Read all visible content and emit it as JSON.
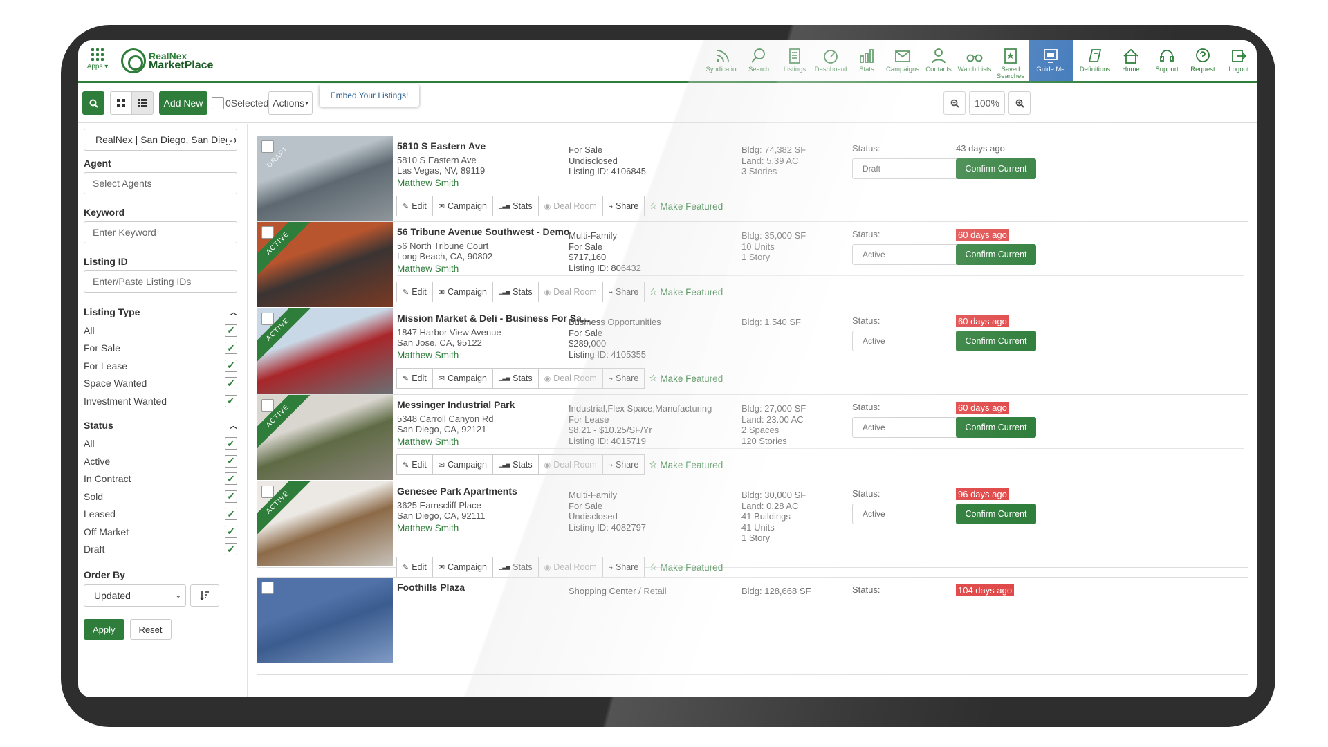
{
  "header": {
    "apps_label": "Apps",
    "logo_line1": "RealNex",
    "logo_line2": "MarketPlace",
    "nav": [
      {
        "label": "Syndication",
        "icon": "rss-icon"
      },
      {
        "label": "Search",
        "icon": "search-icon"
      },
      {
        "label": "Listings",
        "icon": "document-icon"
      },
      {
        "label": "Dashboard",
        "icon": "gauge-icon"
      },
      {
        "label": "Stats",
        "icon": "bar-chart-icon"
      },
      {
        "label": "Campaigns",
        "icon": "envelope-icon"
      },
      {
        "label": "Contacts",
        "icon": "person-icon"
      },
      {
        "label": "Watch Lists",
        "icon": "binoculars-icon"
      },
      {
        "label": "Saved Searches",
        "icon": "bookmark-icon"
      },
      {
        "label": "Guide Me",
        "icon": "guide-icon",
        "active": true
      },
      {
        "label": "Definitions",
        "icon": "book-icon"
      },
      {
        "label": "Home",
        "icon": "home-icon"
      },
      {
        "label": "Support",
        "icon": "headset-icon"
      },
      {
        "label": "Request",
        "icon": "question-icon"
      },
      {
        "label": "Logout",
        "icon": "logout-icon"
      }
    ]
  },
  "toolbar": {
    "add_new": "Add New",
    "selected_count": "0",
    "selected_label": "Selected",
    "actions": "Actions",
    "embed": "Embed Your Listings!",
    "zoom": "100%"
  },
  "sidebar": {
    "account": "RealNex | San Diego, San Diego",
    "agent_label": "Agent",
    "agent_placeholder": "Select Agents",
    "keyword_label": "Keyword",
    "keyword_placeholder": "Enter Keyword",
    "listing_id_label": "Listing ID",
    "listing_id_placeholder": "Enter/Paste Listing IDs",
    "listing_type_label": "Listing Type",
    "listing_types": [
      "All",
      "For Sale",
      "For Lease",
      "Space Wanted",
      "Investment Wanted"
    ],
    "status_label": "Status",
    "statuses": [
      "All",
      "Active",
      "In Contract",
      "Sold",
      "Leased",
      "Off Market",
      "Draft"
    ],
    "order_label": "Order By",
    "order_value": "Updated",
    "apply": "Apply",
    "reset": "Reset"
  },
  "action_labels": {
    "edit": "Edit",
    "campaign": "Campaign",
    "stats": "Stats",
    "deal_room": "Deal Room",
    "share": "Share",
    "featured": "Make Featured",
    "status": "Status:",
    "confirm": "Confirm Current"
  },
  "listings": [
    {
      "title": "5810 S Eastern Ave",
      "addr1": "5810 S Eastern Ave",
      "addr2": "Las Vegas, NV, 89119",
      "agent": "Matthew Smith",
      "col2": [
        "For Sale",
        "Undisclosed",
        "Listing ID: 4106845"
      ],
      "col3": [
        "Bldg: 74,382 SF",
        "Land: 5.39 AC",
        "3 Stories"
      ],
      "status": "Draft",
      "ribbon": "DRAFT",
      "days": "43 days ago",
      "overdue": false,
      "photo_colors": [
        "#b9c2c8",
        "#5d6870",
        "#8e969b"
      ]
    },
    {
      "title": "56 Tribune Avenue Southwest - Demo",
      "addr1": "56 North Tribune Court",
      "addr2": "Long Beach, CA, 90802",
      "agent": "Matthew Smith",
      "col2": [
        "Multi-Family",
        "For Sale",
        "$717,160",
        "Listing ID: 806432"
      ],
      "col3": [
        "Bldg: 35,000 SF",
        "10 Units",
        "1 Story"
      ],
      "status": "Active",
      "ribbon": "ACTIVE",
      "days": "60 days ago",
      "overdue": true,
      "photo_colors": [
        "#b8552e",
        "#3a3433",
        "#7a3a24"
      ]
    },
    {
      "title": "Mission Market & Deli - Business For Sa...",
      "addr1": "1847 Harbor View Avenue",
      "addr2": "San Jose, CA, 95122",
      "agent": "Matthew Smith",
      "col2": [
        "Business Opportunities",
        "For Sale",
        "$289,000",
        "Listing ID: 4105355"
      ],
      "col3": [
        "Bldg: 1,540 SF"
      ],
      "status": "Active",
      "ribbon": "ACTIVE",
      "days": "60 days ago",
      "overdue": true,
      "photo_colors": [
        "#c9d8e6",
        "#a8262a",
        "#6b6f73"
      ]
    },
    {
      "title": "Messinger Industrial Park",
      "addr1": "5348 Carroll Canyon Rd",
      "addr2": "San Diego, CA, 92121",
      "agent": "Matthew Smith",
      "col2": [
        "Industrial,Flex Space,Manufacturing",
        "For Lease",
        "$8.21 - $10.25/SF/Yr",
        "Listing ID: 4015719"
      ],
      "col3": [
        "Bldg: 27,000 SF",
        "Land: 23.00 AC",
        "2 Spaces",
        "120 Stories"
      ],
      "status": "Active",
      "ribbon": "ACTIVE",
      "days": "60 days ago",
      "overdue": true,
      "photo_colors": [
        "#d9d6cf",
        "#5f6b45",
        "#8a8478"
      ]
    },
    {
      "title": "Genesee Park Apartments",
      "addr1": "3625 Earnscliff Place",
      "addr2": "San Diego, CA, 92111",
      "agent": "Matthew Smith",
      "col2": [
        "Multi-Family",
        "For Sale",
        "Undisclosed",
        "Listing ID: 4082797"
      ],
      "col3": [
        "Bldg: 30,000 SF",
        "Land: 0.28 AC",
        "41 Buildings",
        "41 Units",
        "1 Story"
      ],
      "status": "Active",
      "ribbon": "ACTIVE",
      "days": "96 days ago",
      "overdue": true,
      "photo_colors": [
        "#ece9e4",
        "#8c6a48",
        "#c7c2ba"
      ]
    },
    {
      "title": "Foothills Plaza",
      "addr1": "",
      "addr2": "",
      "agent": "",
      "col2": [
        "Shopping Center / Retail"
      ],
      "col3": [
        "Bldg: 128,668 SF"
      ],
      "status": "",
      "ribbon": "",
      "days": "104 days ago",
      "overdue": true,
      "photo_colors": [
        "#5072a8",
        "#3b5c8f",
        "#7f9ac4"
      ]
    }
  ]
}
